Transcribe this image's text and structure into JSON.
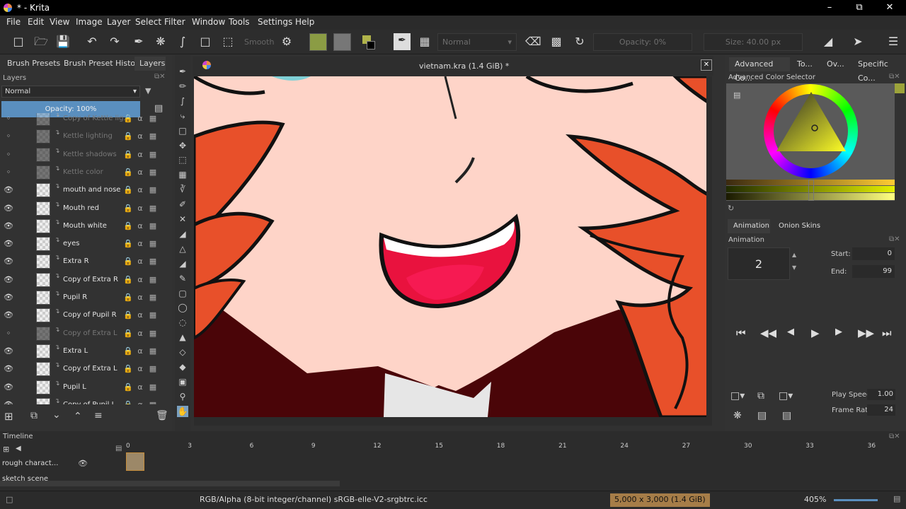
{
  "window": {
    "title": "* - Krita"
  },
  "menu": [
    "File",
    "Edit",
    "View",
    "Image",
    "Layer",
    "Select",
    "Filter",
    "Window",
    "Tools",
    "Settings",
    "Help"
  ],
  "toolbar": {
    "smooth_label": "Smooth",
    "blend_mode": "Normal",
    "opacity": "Opacity: 0%",
    "size": "Size: 40.00 px"
  },
  "left_tabs": [
    "Brush Presets",
    "Brush Preset History",
    "Layers"
  ],
  "layers_panel": {
    "title": "Layers",
    "blend_mode": "Normal",
    "opacity": "Opacity:  100%",
    "layers": [
      {
        "name": "Copy of Kettle lig...",
        "visible": false
      },
      {
        "name": "Kettle lighting",
        "visible": false
      },
      {
        "name": "Kettle shadows",
        "visible": false
      },
      {
        "name": "Kettle color",
        "visible": false
      },
      {
        "name": "mouth and nose",
        "visible": true
      },
      {
        "name": "Mouth red",
        "visible": true
      },
      {
        "name": "Mouth white",
        "visible": true
      },
      {
        "name": "eyes",
        "visible": true
      },
      {
        "name": "Extra R",
        "visible": true
      },
      {
        "name": "Copy of Extra R",
        "visible": true
      },
      {
        "name": "Pupil R",
        "visible": true
      },
      {
        "name": "Copy of Pupil R",
        "visible": true
      },
      {
        "name": "Copy of Extra L",
        "visible": false
      },
      {
        "name": "Extra L",
        "visible": true
      },
      {
        "name": "Copy of Extra L",
        "visible": true
      },
      {
        "name": "Pupil L",
        "visible": true
      },
      {
        "name": "Copy of Pupil L",
        "visible": true
      }
    ]
  },
  "canvas": {
    "doc_title": "vietnam.kra (1.4 GiB) *"
  },
  "right_tabs": [
    "Advanced Co...",
    "To...",
    "Ov...",
    "Specific Co..."
  ],
  "color_selector": {
    "title": "Advanced Color Selector"
  },
  "animation_tabs": [
    "Animation",
    "Onion Skins"
  ],
  "animation": {
    "title": "Animation",
    "current_frame": "2",
    "start_label": "Start:",
    "start": "0",
    "end_label": "End:",
    "end": "99",
    "play_speed_label": "Play Speed:",
    "play_speed": "1.00",
    "frame_rate_label": "Frame Rate:",
    "frame_rate": "24"
  },
  "timeline": {
    "title": "Timeline",
    "ruler": [
      "0",
      "3",
      "6",
      "9",
      "12",
      "15",
      "18",
      "21",
      "24",
      "27",
      "30",
      "33",
      "36"
    ],
    "layer_rows": [
      "rough charact...",
      "sketch scene"
    ]
  },
  "status": {
    "color_space": "RGB/Alpha (8-bit integer/channel)  sRGB-elle-V2-srgbtrc.icc",
    "image_size": "5,000 x 3,000 (1.4 GiB)",
    "zoom": "405%"
  },
  "colors": {
    "accent_blue": "#5a8fbf",
    "foreground": "#b0b34a",
    "skin": "#fed4c8",
    "hair": "#e8502a",
    "mouth_red": "#e9123e"
  }
}
